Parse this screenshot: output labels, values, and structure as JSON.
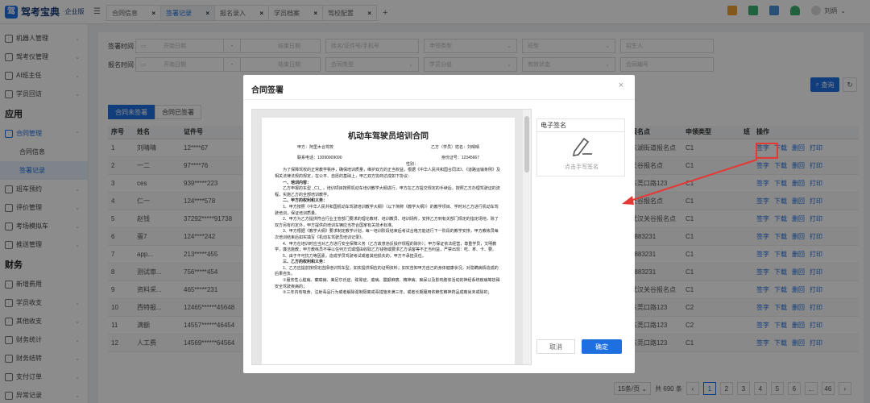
{
  "app": {
    "logo_text": "驾考宝典",
    "logo_sub": "·企业版",
    "user": "刘炳"
  },
  "tabs": [
    {
      "label": "合同信息",
      "active": false
    },
    {
      "label": "签署记录",
      "active": true
    },
    {
      "label": "报名录入",
      "active": false
    },
    {
      "label": "学员档案",
      "active": false
    },
    {
      "label": "驾校配置",
      "active": false
    }
  ],
  "sidebar": {
    "items": [
      {
        "label": "机器人管理"
      },
      {
        "label": "驾考仪管理"
      },
      {
        "label": "AI班主任"
      },
      {
        "label": "学员回访"
      }
    ],
    "group1": "应用",
    "app_items": [
      {
        "label": "合同管理"
      }
    ],
    "sub_items": [
      {
        "label": "合同信息",
        "active": false
      },
      {
        "label": "签署记录",
        "active": true
      }
    ],
    "items2": [
      {
        "label": "班车预约"
      },
      {
        "label": "评价管理"
      },
      {
        "label": "考场模拟车"
      },
      {
        "label": "推送管理"
      }
    ],
    "group2": "财务",
    "fin_items": [
      {
        "label": "新增费用"
      },
      {
        "label": "学员收支"
      },
      {
        "label": "其他收支"
      },
      {
        "label": "财务统计"
      },
      {
        "label": "财务结转"
      },
      {
        "label": "支付订单"
      },
      {
        "label": "异常记录"
      }
    ]
  },
  "filters": {
    "sign_time": "签署时间",
    "report_time": "报名时间",
    "start_date": "开始日期",
    "end_date": "结束日期",
    "dash": "-",
    "row1": [
      "姓名/证件号/手机号",
      "申领类型",
      "班型",
      "招生人"
    ],
    "row2": [
      "合同类型",
      "学员分组",
      "有效状态",
      "合同编号"
    ],
    "query": "查询",
    "query_icon": "search-icon"
  },
  "subtabs": [
    {
      "label": "合同未签署",
      "active": true
    },
    {
      "label": "合同已签署",
      "active": false
    }
  ],
  "table": {
    "headers": [
      "序号",
      "姓名",
      "证件号",
      "",
      "",
      "",
      "报名点",
      "申领类型",
      "班",
      "操作"
    ],
    "rows": [
      {
        "idx": "1",
        "name": "刘晴晴",
        "id": "12****67",
        "spot": "东湖街道报名点",
        "type": "C1"
      },
      {
        "idx": "2",
        "name": "一二",
        "id": "97****76",
        "spot": "天谷报名点",
        "type": "C1"
      },
      {
        "idx": "3",
        "name": "ces",
        "id": "939*****223",
        "spot": "东莞口路123",
        "type": "C1"
      },
      {
        "idx": "4",
        "name": "仁一",
        "id": "124****578",
        "spot": "天谷报名点",
        "type": "C1"
      },
      {
        "idx": "5",
        "name": "赵钱",
        "id": "37292*****91738",
        "spot": "武汉关谷报名点",
        "type": "C1"
      },
      {
        "idx": "6",
        "name": "蛋7",
        "id": "124****242",
        "spot": "3883231",
        "type": "C1"
      },
      {
        "idx": "7",
        "name": "app...",
        "id": "213*****455",
        "spot": "3883231",
        "type": "C1"
      },
      {
        "idx": "8",
        "name": "测试审...",
        "id": "756*****454",
        "spot": "3883231",
        "type": "C1"
      },
      {
        "idx": "9",
        "name": "资料采...",
        "id": "465*****231",
        "spot": "武汉关谷报名点",
        "type": "C1"
      },
      {
        "idx": "10",
        "name": "西特报...",
        "id": "12465******45648",
        "spot": "东莞口路123",
        "type": "C2"
      },
      {
        "idx": "11",
        "name": "满额",
        "id": "14557******46454",
        "spot": "东莞口路123",
        "type": "C2"
      },
      {
        "idx": "12",
        "name": "人工费",
        "id": "14569******64564",
        "spot": "东莞口路123",
        "type": "C1"
      }
    ],
    "ops": [
      "签字",
      "下载",
      "删回",
      "打印"
    ]
  },
  "pager": {
    "size": "15条/页",
    "total": "共 690 条",
    "pages": [
      "1",
      "2",
      "3",
      "4",
      "5",
      "6",
      "...",
      "46"
    ],
    "prev": "‹",
    "next": "›",
    "current": "1"
  },
  "modal": {
    "title": "合同签署",
    "close": "×",
    "doc": {
      "title": "机动车驾驶员培训合同",
      "party_a": "甲方：阿里木合驾校",
      "party_b": "乙方（学员）姓名：刘晴晴",
      "contact": "联系电话：13090909090",
      "idno": "身份证号：12345667",
      "gender": "性别：",
      "p1": "为了保障驾校的正常教学秩序，确保培训质量，维护双方的正当权益，根据《中华人民共和国合同法》、《道路运输条例》及相关法律法规的规定，在公平、自愿的基础上，甲乙双方协商达成如下协议：",
      "h1": "一、培训内容：",
      "p2": "乙方申报的车型 _C1_ ，培训项目按照机动车培训教学大纲进行，甲方在乙方提交规定的手续后，按照乙方办理驾驶证的流程，实施乙方的全部培训教学。",
      "h2": "二、甲方的权利和义务：",
      "p3": "1、甲方按照《中华人民共和国机动车驾驶培训教学大纲》（以下简称《教学大纲》）的教学项目、学时对乙方进行机动车驾驶培训，保证培训质量。",
      "p4": "2、甲方为乙方提供符合行业主管部门要求的理论教材、培训教员、培训场所，安排乙方到有关部门规定的指定场地，除了双方另有约定外，甲方提供的培训车辆应当符合国家有关技术标准。",
      "p5": "3、甲方根据《教学大纲》要求制定教学计划，每一培训阶段结束后考试合格方能进行下一阶段的教学安排，甲方教练员每次培训结束后如实填写《机动车驾驶员培训记录》。",
      "p6": "4、甲方在培训时应当对乙方进行安全保障义务（乙方故意违反操作规程的除外）；甲方保证依法经营，尊重学员，文明教学，廉洁施教；甲方教练员不得以任何方式或理由收取乙方钱物或要求乙方请客等不正当利益，严禁出现：吃、拿、卡、要。",
      "p7": "5、由于不可抗力等因素，造成学员驾驶考试或者其他损失的，甲方不承担责任。",
      "h3": "三、乙方的权利和义务：",
      "p8": "1、乙方应提前按规定选择培训驾车型，如实提供相应的证明资料；如实告知甲方自己的身体健康状况，对隐瞒病情造成的后果自负。",
      "p9": "①服务性心脏病、癫痫病、美尼尔氏症、眩晕症、癔病、震颤麻痹、精神病、痴呆以及影响肢体活动的神经系统疾病等妨碍安全驾驶疾病的；",
      "p10": "②三年内有吸食、注射毒品行为或者解除强制隔离戒毒措施未满三年，或者长期服用依赖性精神药品成瘾尚未戒除的；"
    },
    "sig_label": "电子签名",
    "sig_hint": "点击手写签名",
    "cancel": "取消",
    "confirm": "确定"
  }
}
